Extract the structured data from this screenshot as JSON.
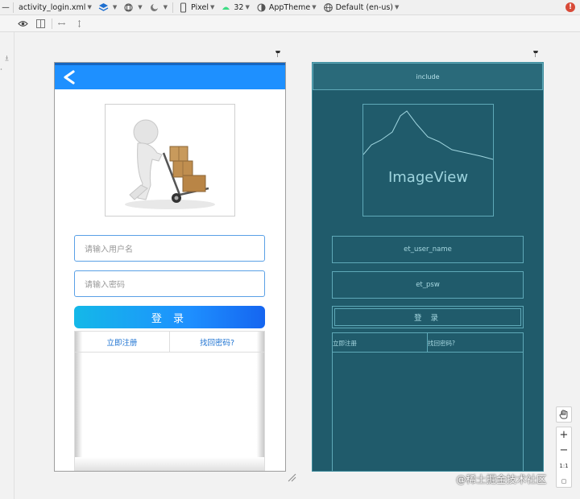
{
  "toolbar": {
    "file_name": "activity_login.xml",
    "device": "Pixel",
    "api_level": "32",
    "theme": "AppTheme",
    "locale": "Default (en-us)"
  },
  "phone": {
    "back_icon": "chevron-left-icon",
    "username_placeholder": "请输入用户名",
    "password_placeholder": "请输入密码",
    "login_label": "登 录",
    "register_link": "立即注册",
    "forgot_link": "找回密码?"
  },
  "blueprint": {
    "include_label": "include",
    "imageview_label": "ImageView",
    "username_id": "et_user_name",
    "password_id": "et_psw",
    "login_label": "登 录",
    "register_link": "立即注册",
    "forgot_link": "找回密码?"
  },
  "zoom": {
    "hand_icon": "hand-icon",
    "zoom_in": "+",
    "zoom_out": "−",
    "actual_size": "1:1"
  },
  "watermark": "@稀土掘金技术社区",
  "colors": {
    "accent": "#1e90ff",
    "blueprint_bg": "#205b6b",
    "error": "#d84a38"
  }
}
